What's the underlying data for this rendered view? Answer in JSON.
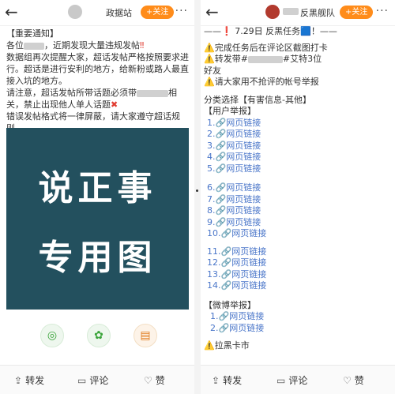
{
  "left": {
    "header": {
      "title": "政据站",
      "follow": "+关注",
      "more": "···"
    },
    "notice": {
      "heading": "【重要通知】",
      "line1": "各位",
      "line1b": "，近期发现大量违规发帖",
      "line2": "数据组再次提醒大家，超话发帖严格按照要求进行。超话是进行安利的地方，给新粉或路人最直接入坑的地方。",
      "line3": "请注意，超话发帖所带话题必须带",
      "line3b": "相关，禁止出现他人单人话题",
      "line4": "错误发帖格式将一律屏蔽，请大家遵守超话规则。",
      "mention": "@"
    },
    "image": {
      "line1": "说正事",
      "line2": "专用图"
    },
    "bottom": {
      "share": "转发",
      "comment": "评论",
      "like": "赞"
    }
  },
  "right": {
    "header": {
      "title": "反黑舰队",
      "follow": "+关注",
      "more": "···"
    },
    "task": "——❗ 7.29日 反黑任务🟦！——",
    "rules": [
      "⚠️完成任务后在评论区截图打卡",
      "⚠️转发带#",
      "#艾特3位",
      "好友",
      "⚠️请大家用不抢评的帐号举报"
    ],
    "category": "分类选择【有害信息-其他】",
    "user_report": "【用户举报】",
    "links_a": [
      "1.🔗网页链接",
      "2.🔗网页链接",
      "3.🔗网页链接",
      "4.🔗网页链接",
      "5.🔗网页链接"
    ],
    "links_b": [
      "6.🔗网页链接",
      "7.🔗网页链接",
      "8.🔗网页链接",
      "9.🔗网页链接",
      "10.🔗网页链接"
    ],
    "links_c": [
      "11.🔗网页链接",
      "12.🔗网页链接",
      "13.🔗网页链接",
      "14.🔗网页链接"
    ],
    "weibo_report": "【微博举报】",
    "links_d": [
      "1.🔗网页链接",
      "2.🔗网页链接"
    ],
    "cut_text": "⚠️拉黑卡市",
    "bottom": {
      "share": "转发",
      "comment": "评论",
      "like": "赞"
    }
  }
}
